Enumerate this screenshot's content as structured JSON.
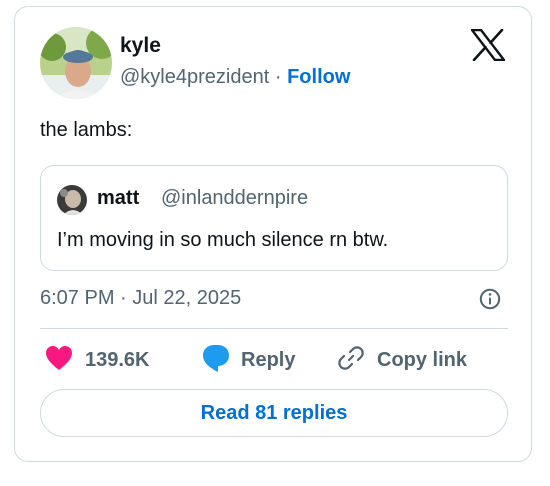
{
  "author": {
    "name": "kyle",
    "handle": "@kyle4prezident",
    "separator": "·",
    "follow_label": "Follow"
  },
  "tweet": {
    "text": "the lambs:",
    "timestamp": "6:07 PM · Jul 22, 2025"
  },
  "quoted_tweet": {
    "name": "matt",
    "handle": "@inlanddernpire",
    "text": "I’m moving in so much silence rn btw."
  },
  "actions": {
    "like_count": "139.6K",
    "reply_label": "Reply",
    "copy_link_label": "Copy link"
  },
  "read_replies_label": "Read 81 replies",
  "colors": {
    "like": "#f91880",
    "reply": "#1d9bf0",
    "link": "#006fd6",
    "secondary_text": "#536471",
    "border": "#cfd9de"
  },
  "icons": {
    "brand": "x-logo-icon",
    "info": "info-icon",
    "like": "heart-icon",
    "reply": "speech-bubble-icon",
    "copy_link": "link-icon"
  }
}
